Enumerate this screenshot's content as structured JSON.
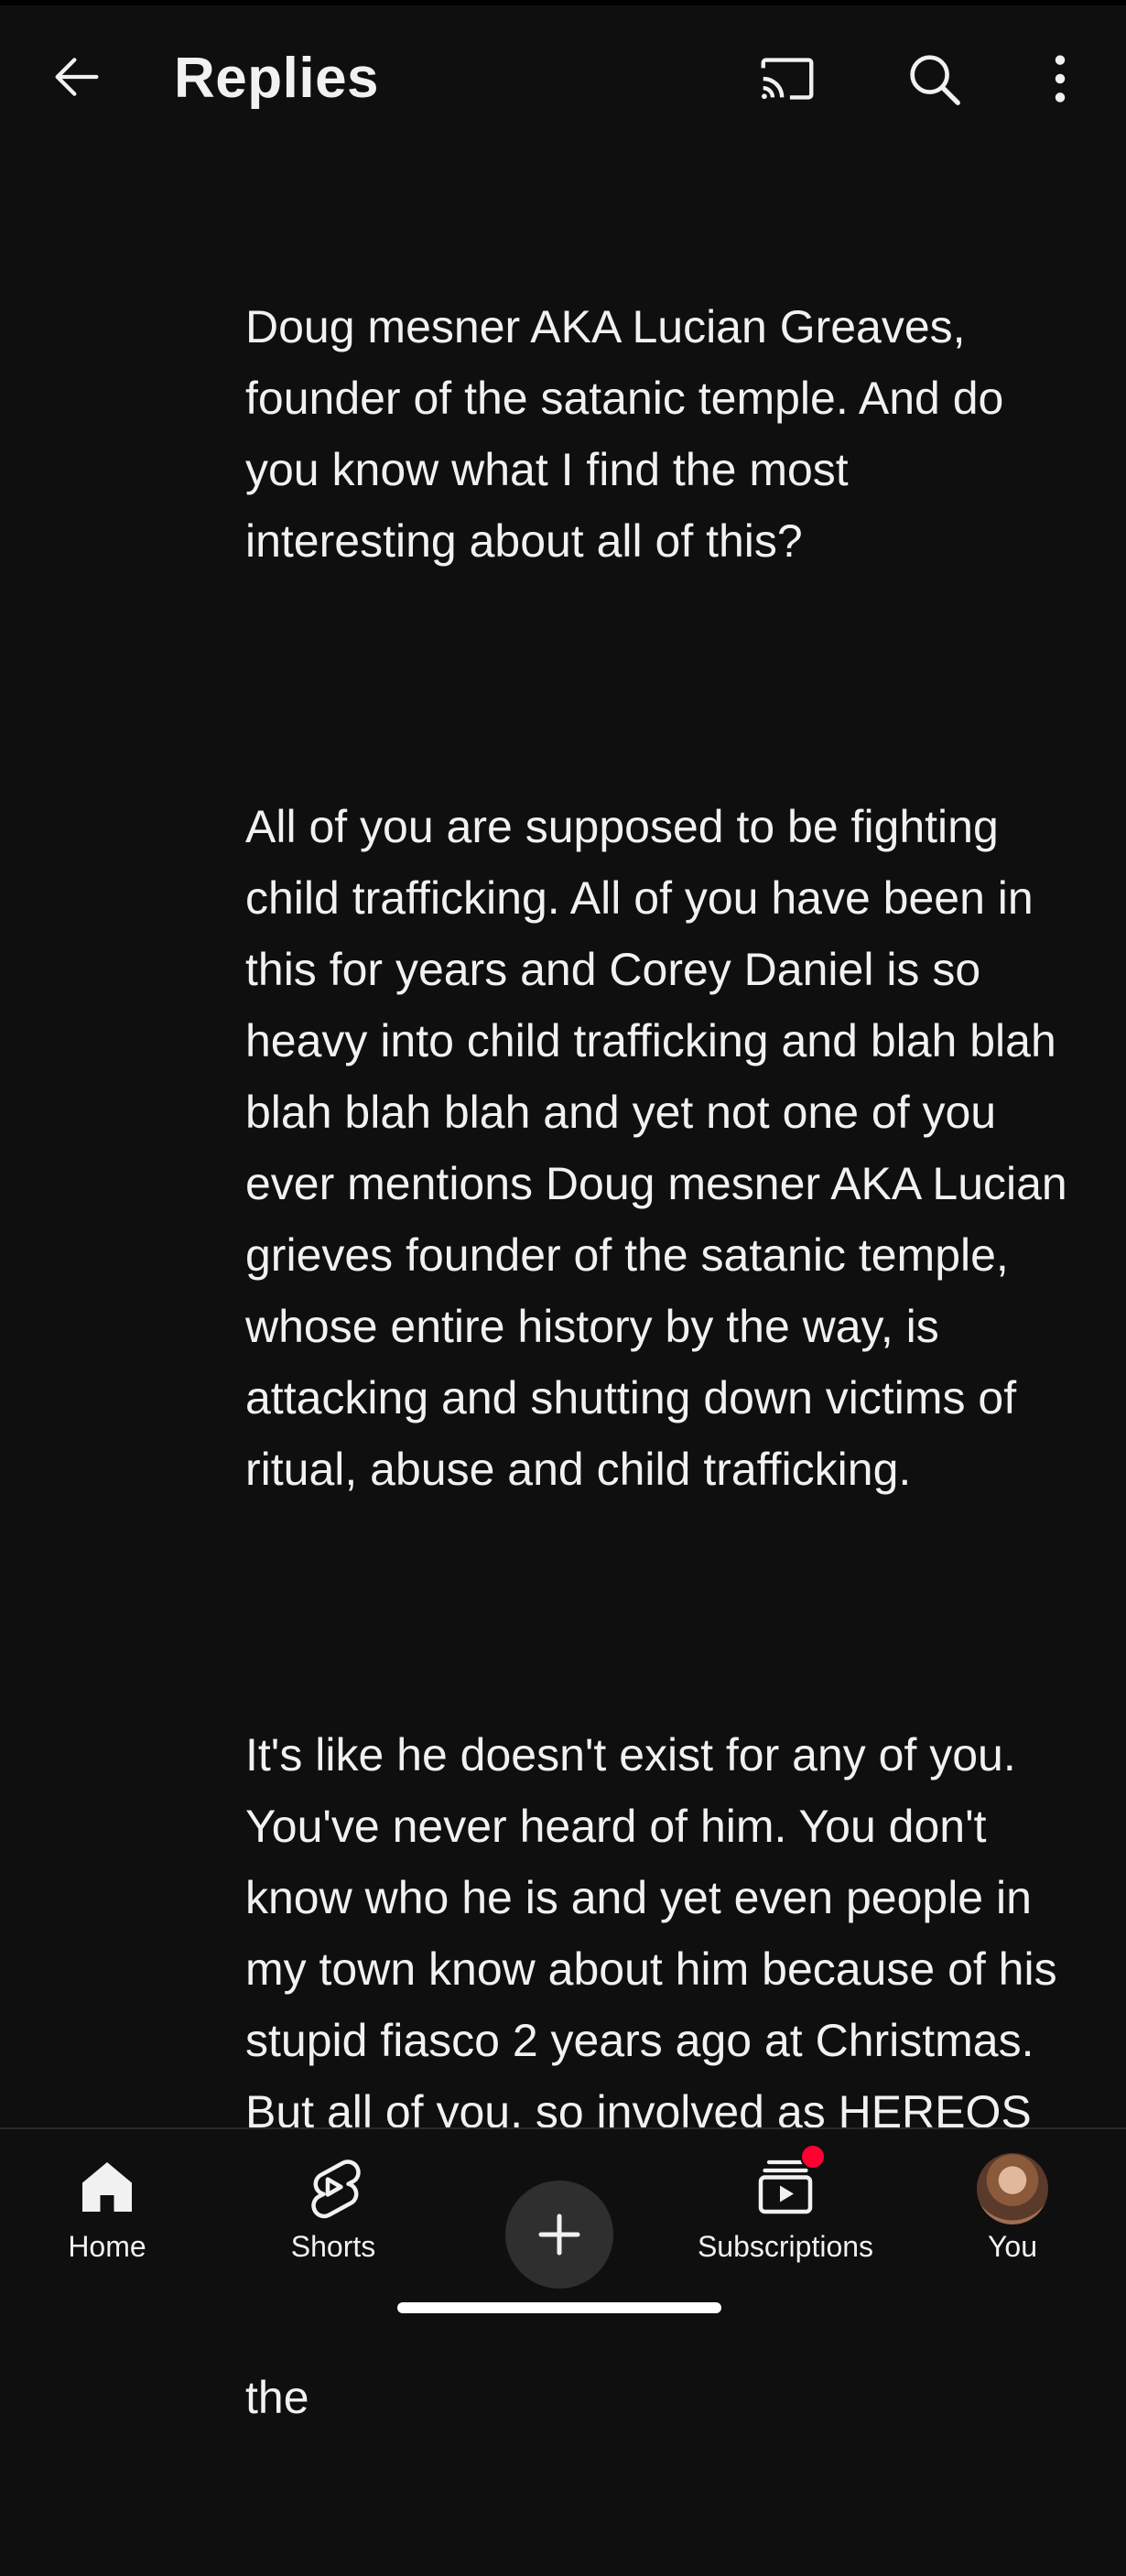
{
  "header": {
    "title": "Replies",
    "icons": {
      "back": "back-arrow-icon",
      "cast": "cast-icon",
      "search": "search-icon",
      "more": "more-vert-icon"
    }
  },
  "comment": {
    "paragraphs": [
      "Doug mesner AKA Lucian Greaves, founder of the satanic temple. And do you know what I find the most interesting about all of this?",
      "All of you are supposed to be fighting child trafficking. All of you have been in this for years and Corey Daniel is so heavy into child trafficking and blah blah blah blah blah and yet not one of you ever mentions Doug mesner AKA Lucian grieves founder of the satanic temple, whose entire history by the way, is attacking and shutting down victims of ritual, abuse and child trafficking.",
      "It's like he doesn't exist for any of you. You've never heard of him. You don't know who he is and yet even people in my town know about him because of his stupid fiasco 2 years ago at Christmas. But all of you, so involved as HEREOS when it comes to victims of child trafficking , not ONE of you supposedly know who Lucian Greaves founder of the"
    ]
  },
  "bottom_nav": {
    "home": "Home",
    "shorts": "Shorts",
    "subscriptions": "Subscriptions",
    "you": "You",
    "icons": {
      "home": "home-icon",
      "shorts": "shorts-icon",
      "create": "plus-icon",
      "subscriptions": "subscriptions-icon",
      "you": "avatar"
    },
    "notification_color": "#ff0033"
  },
  "colors": {
    "background": "#0f0f0f",
    "text": "#f1f1f1"
  }
}
